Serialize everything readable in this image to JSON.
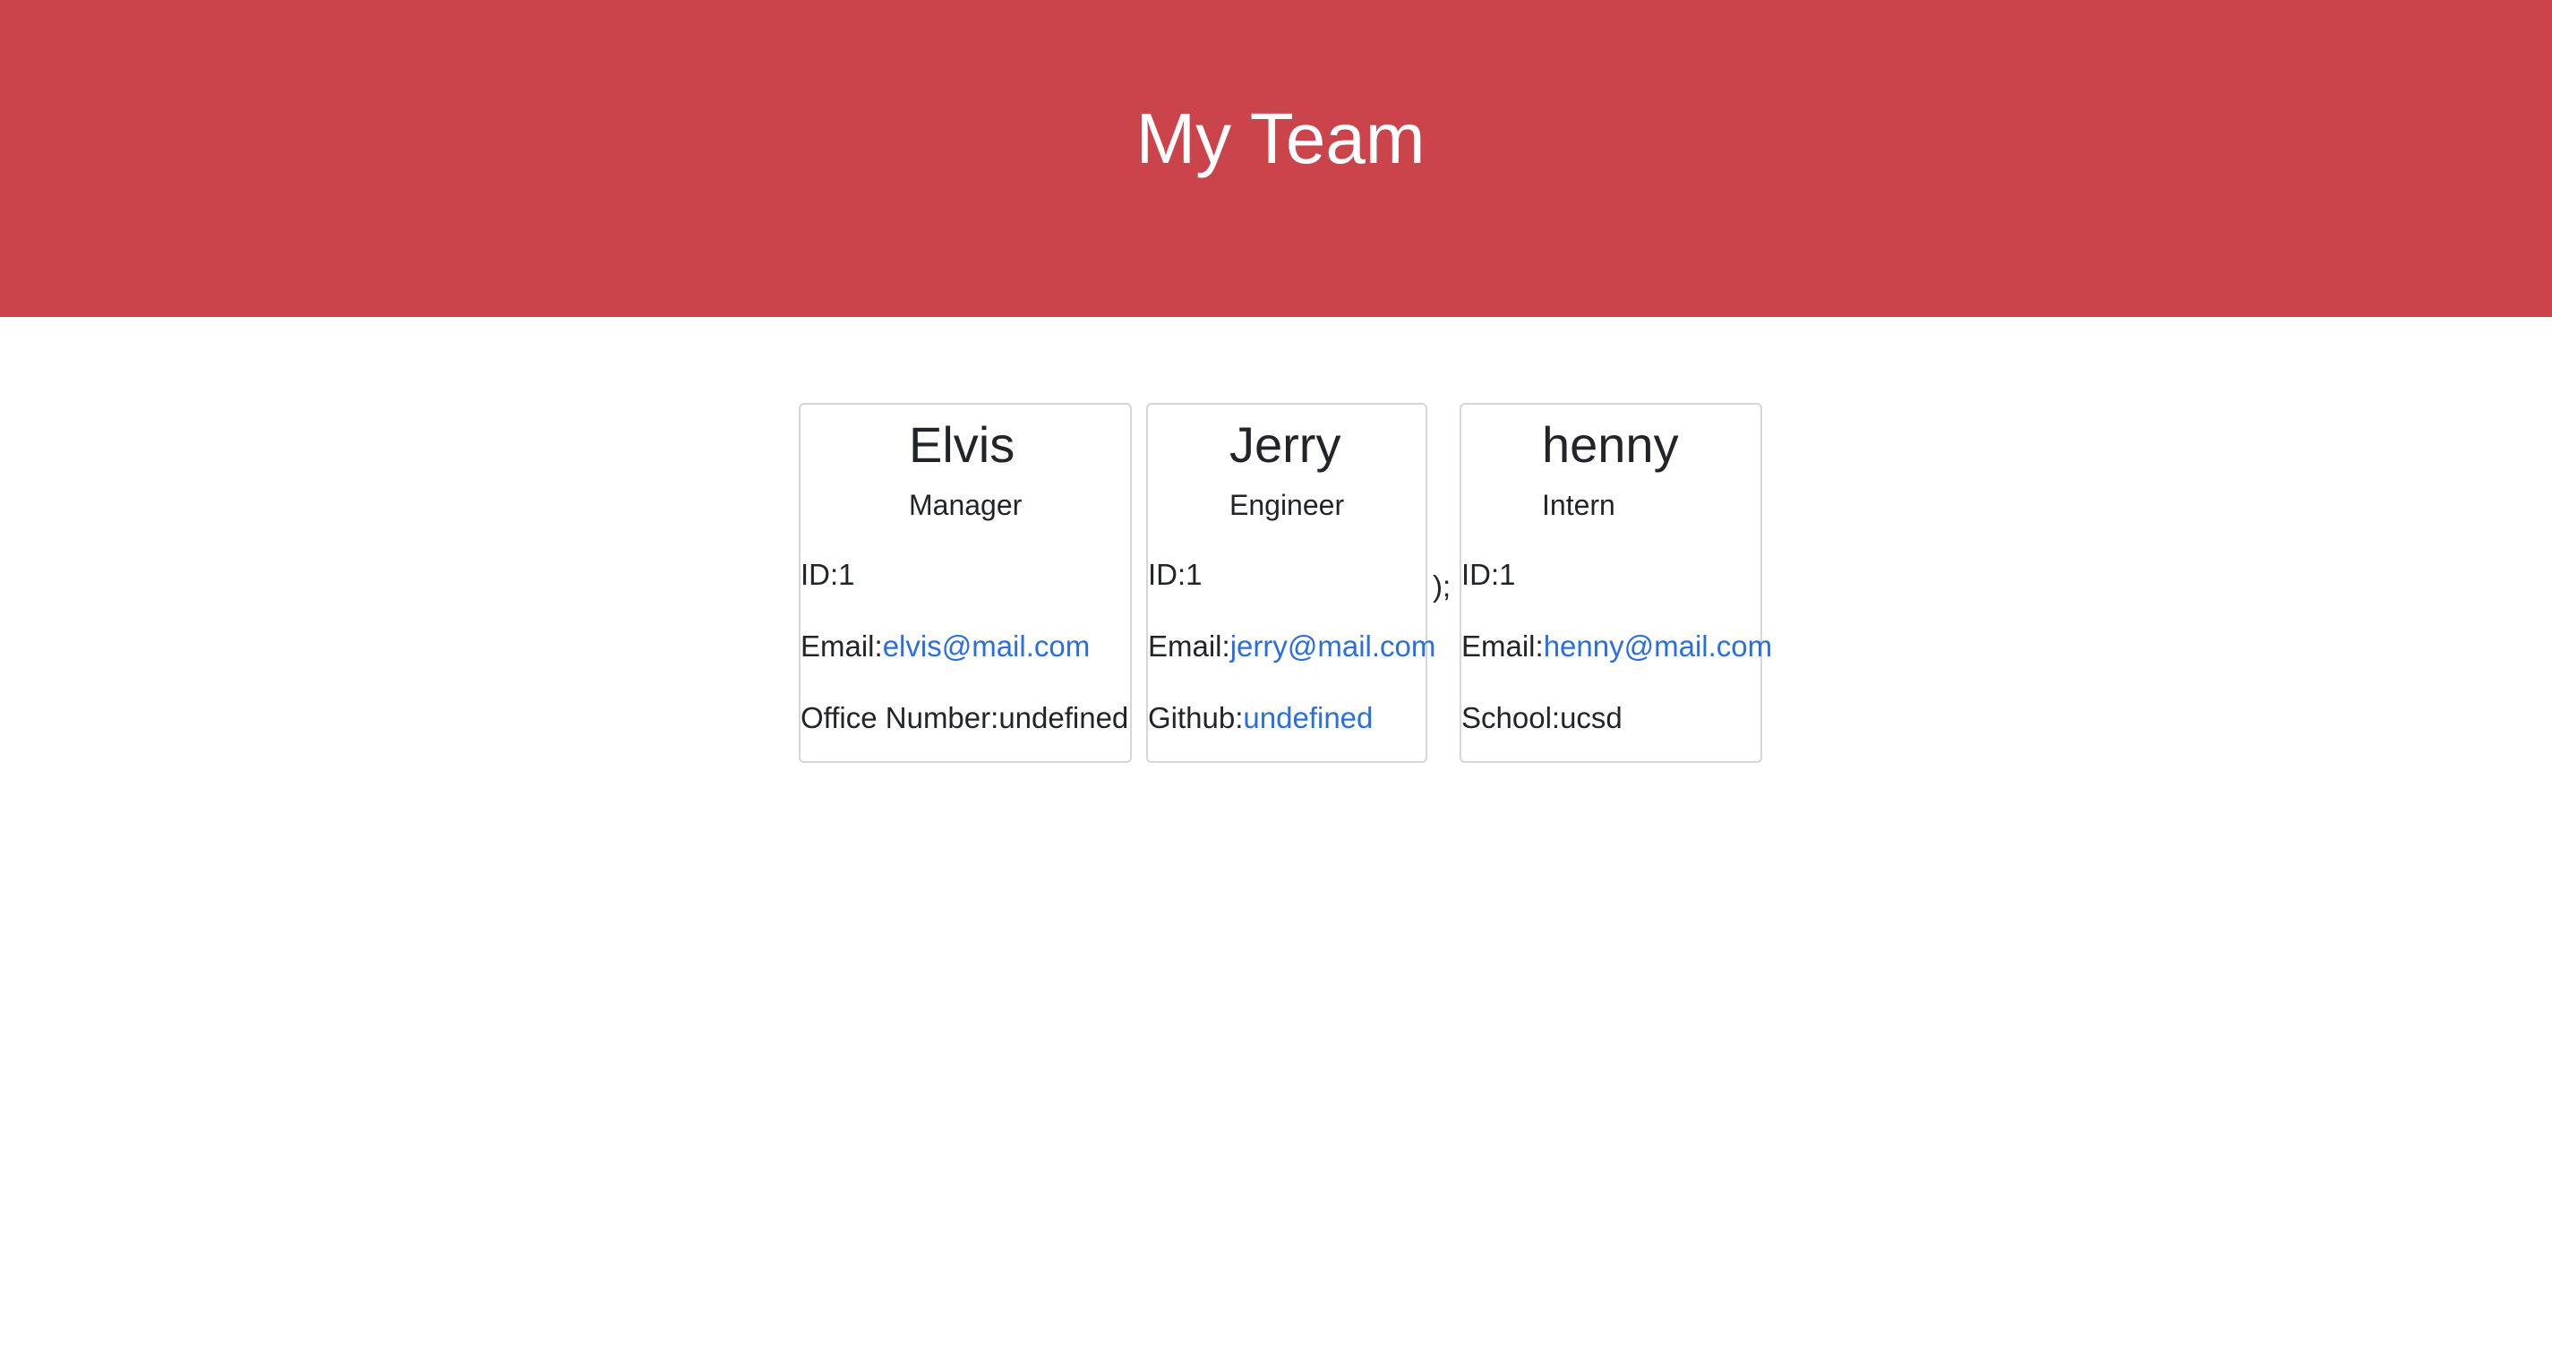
{
  "header": {
    "title": "My Team"
  },
  "stray_text": ");",
  "cards": [
    {
      "name": "Elvis",
      "role": "Manager",
      "id_label": "ID:",
      "id": "1",
      "email_label": "Email:",
      "email": "elvis@mail.com",
      "extra_label": "Office Number:",
      "extra_value": "undefined"
    },
    {
      "name": "Jerry",
      "role": "Engineer",
      "id_label": "ID:",
      "id": "1",
      "email_label": "Email:",
      "email": "jerry@mail.com",
      "extra_label": "Github:",
      "extra_value": "undefined"
    },
    {
      "name": "henny",
      "role": "Intern",
      "id_label": "ID:",
      "id": "1",
      "email_label": "Email:",
      "email": "henny@mail.com",
      "extra_label": "School:",
      "extra_value": "ucsd"
    }
  ],
  "colors": {
    "header_bg": "#cc444b",
    "link": "#2a6fe0",
    "card_border": "#d6d6d6"
  }
}
